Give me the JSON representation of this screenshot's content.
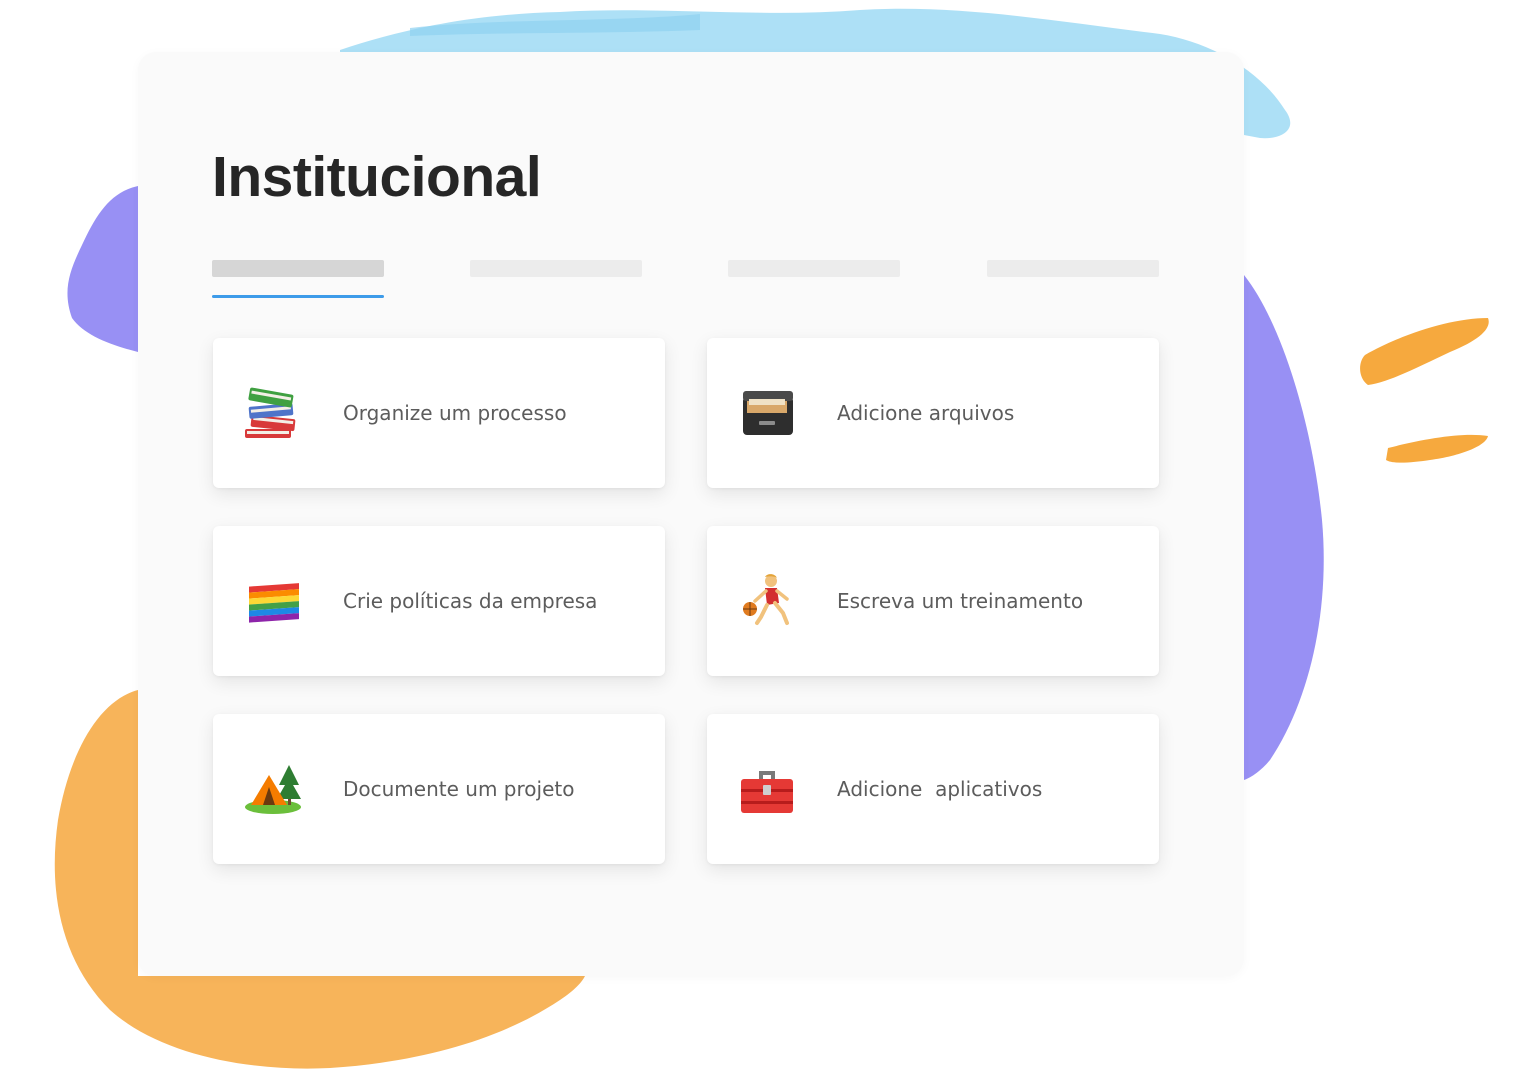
{
  "page": {
    "title": "Institucional"
  },
  "tabs": [
    {
      "label": "",
      "active": true
    },
    {
      "label": "",
      "active": false
    },
    {
      "label": "",
      "active": false
    },
    {
      "label": "",
      "active": false
    }
  ],
  "cards": [
    {
      "label": "Organize um processo",
      "icon": "books-icon"
    },
    {
      "label": "Adicione arquivos",
      "icon": "file-cabinet-icon"
    },
    {
      "label": "Crie políticas da empresa",
      "icon": "rainbow-flag-icon"
    },
    {
      "label": "Escreva um treinamento",
      "icon": "basketball-player-icon"
    },
    {
      "label": "Documente um projeto",
      "icon": "camping-tent-icon"
    },
    {
      "label": "Adicione  aplicativos",
      "icon": "toolbox-icon"
    }
  ],
  "colors": {
    "accent": "#3d9be9",
    "panel_background": "#fafafa",
    "title": "#262626",
    "card_text": "#5c5c5c",
    "decor_blue": "#9fdaf5",
    "decor_purple": "#9890f4",
    "decor_orange": "#f7b45a"
  }
}
